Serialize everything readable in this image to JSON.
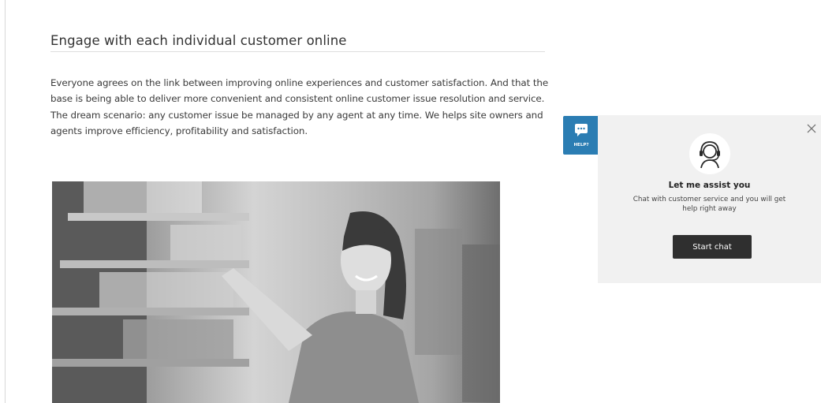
{
  "article": {
    "title": "Engage with each individual customer online",
    "body": "Everyone agrees on the link between improving online experiences and customer satisfaction. And that the base is being able to deliver more convenient and consistent online customer issue resolution and service. The dream scenario: any customer issue  be managed by any agent at any time. We helps site owners and agents improve efficiency, profitability and satisfaction."
  },
  "help_tab": {
    "label": "HELP?",
    "icon": "chat-bubble-icon",
    "color": "#2b7db3"
  },
  "chat_panel": {
    "icon": "support-agent-icon",
    "title": "Let me assist you",
    "subtitle": "Chat with customer service and you will get help right away",
    "start_button_label": "Start chat",
    "close_icon": "close-icon"
  }
}
